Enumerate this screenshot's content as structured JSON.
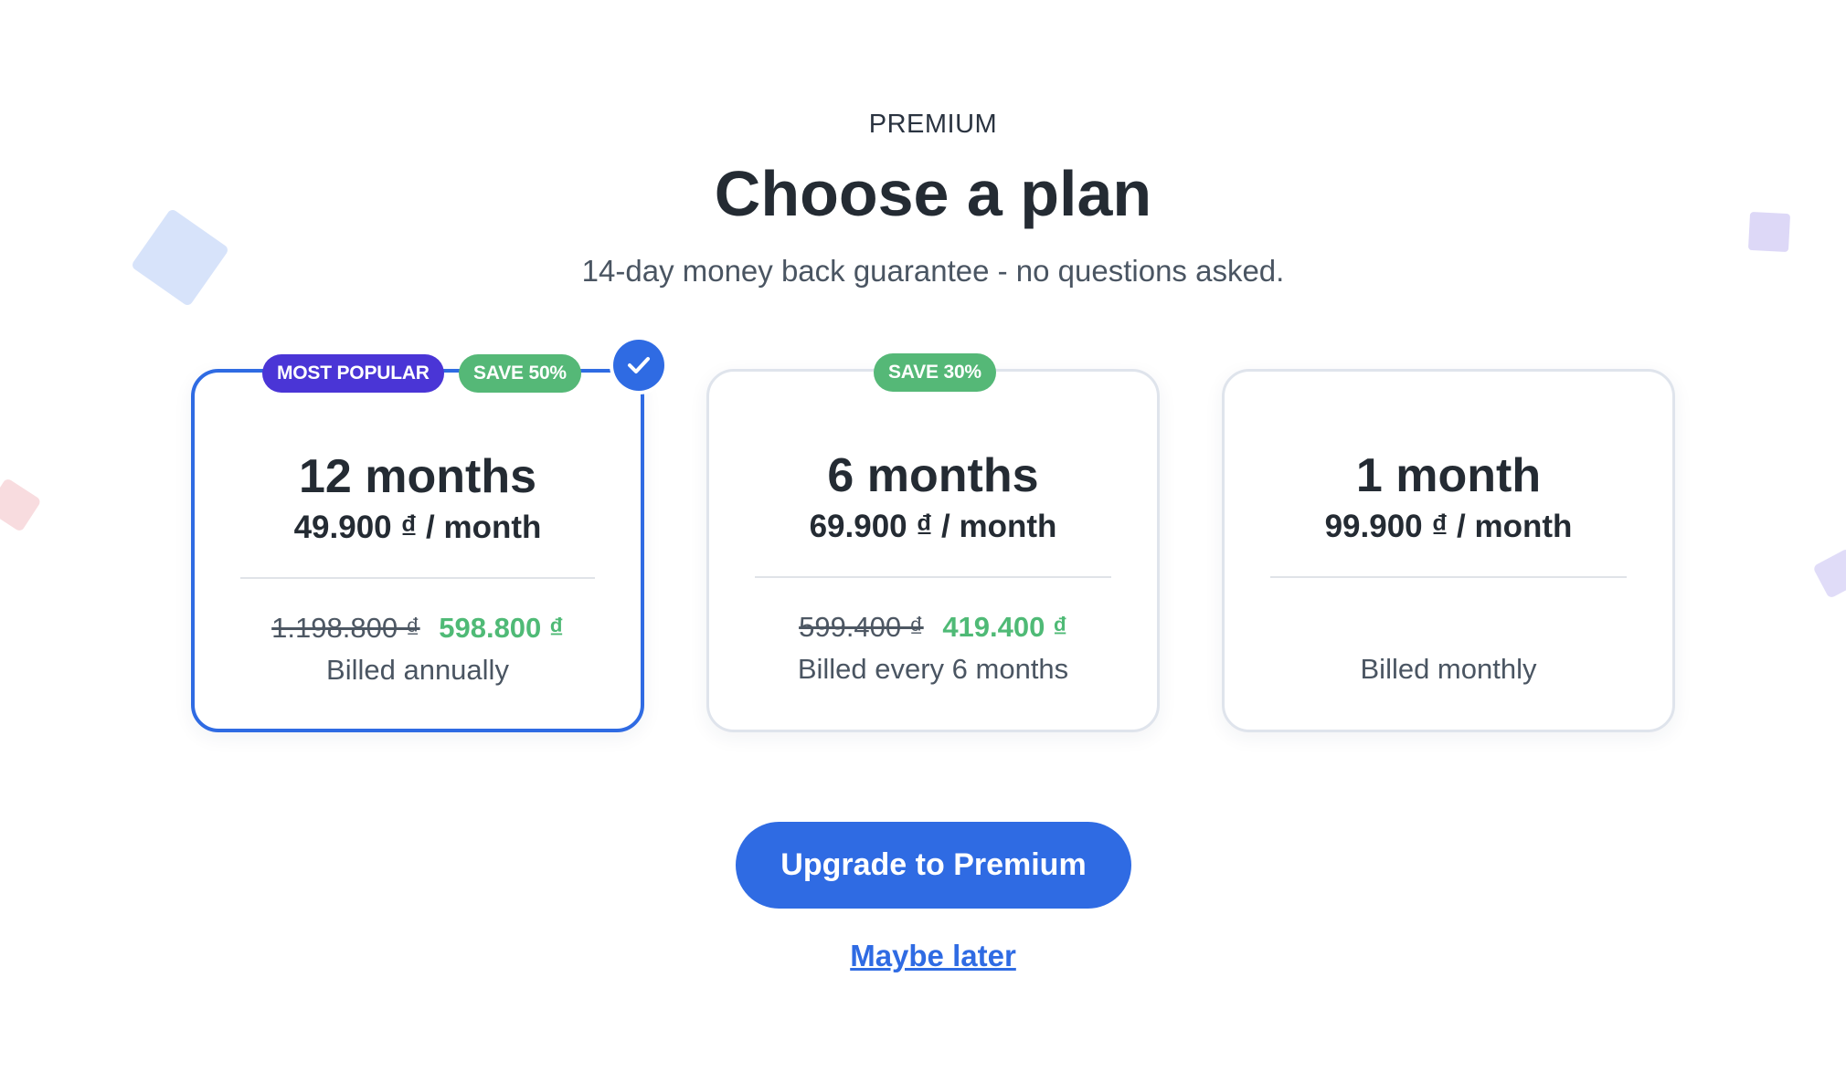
{
  "header": {
    "eyebrow": "PREMIUM",
    "title": "Choose a plan",
    "subtitle": "14-day money back guarantee - no questions asked."
  },
  "plans": [
    {
      "duration": "12 months",
      "per_month": "49.900 ₫ / month",
      "old_price": "1.198.800 ₫",
      "new_price": "598.800 ₫",
      "billing": "Billed annually",
      "badges": [
        "MOST POPULAR",
        "SAVE 50%"
      ],
      "selected": true
    },
    {
      "duration": "6 months",
      "per_month": "69.900 ₫ / month",
      "old_price": "599.400 ₫",
      "new_price": "419.400 ₫",
      "billing": "Billed every 6 months",
      "badges": [
        "SAVE 30%"
      ],
      "selected": false
    },
    {
      "duration": "1 month",
      "per_month": "99.900 ₫ / month",
      "billing": "Billed monthly",
      "badges": [],
      "selected": false
    }
  ],
  "actions": {
    "primary": "Upgrade to Premium",
    "secondary": "Maybe later"
  },
  "colors": {
    "accent": "#2f6be3",
    "popular_badge": "#4a35d6",
    "save_badge": "#55b877",
    "discount_price": "#4fba76"
  },
  "icons": {
    "selected_indicator": "check-icon"
  }
}
